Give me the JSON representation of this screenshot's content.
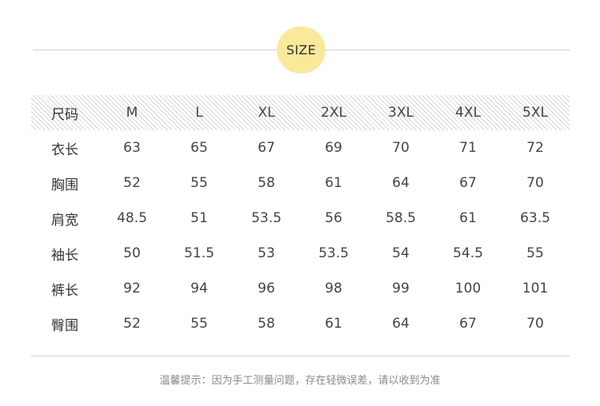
{
  "badge": "SIZE",
  "table": {
    "header": [
      "尺码",
      "M",
      "L",
      "XL",
      "2XL",
      "3XL",
      "4XL",
      "5XL"
    ],
    "rows": [
      {
        "label": "衣长",
        "values": [
          "63",
          "65",
          "67",
          "69",
          "70",
          "71",
          "72"
        ]
      },
      {
        "label": "胸围",
        "values": [
          "52",
          "55",
          "58",
          "61",
          "64",
          "67",
          "70"
        ]
      },
      {
        "label": "肩宽",
        "values": [
          "48.5",
          "51",
          "53.5",
          "56",
          "58.5",
          "61",
          "63.5"
        ]
      },
      {
        "label": "袖长",
        "values": [
          "50",
          "51.5",
          "53",
          "53.5",
          "54",
          "54.5",
          "55"
        ]
      },
      {
        "label": "裤长",
        "values": [
          "92",
          "94",
          "96",
          "98",
          "99",
          "100",
          "101"
        ]
      },
      {
        "label": "臀围",
        "values": [
          "52",
          "55",
          "58",
          "61",
          "64",
          "67",
          "70"
        ]
      }
    ]
  },
  "note": "温馨提示：因为手工测量问题，存在轻微误差，请以收到为准",
  "colors": {
    "badge": "#f9e99a",
    "rule": "#cfcfcf",
    "text": "#444444"
  }
}
